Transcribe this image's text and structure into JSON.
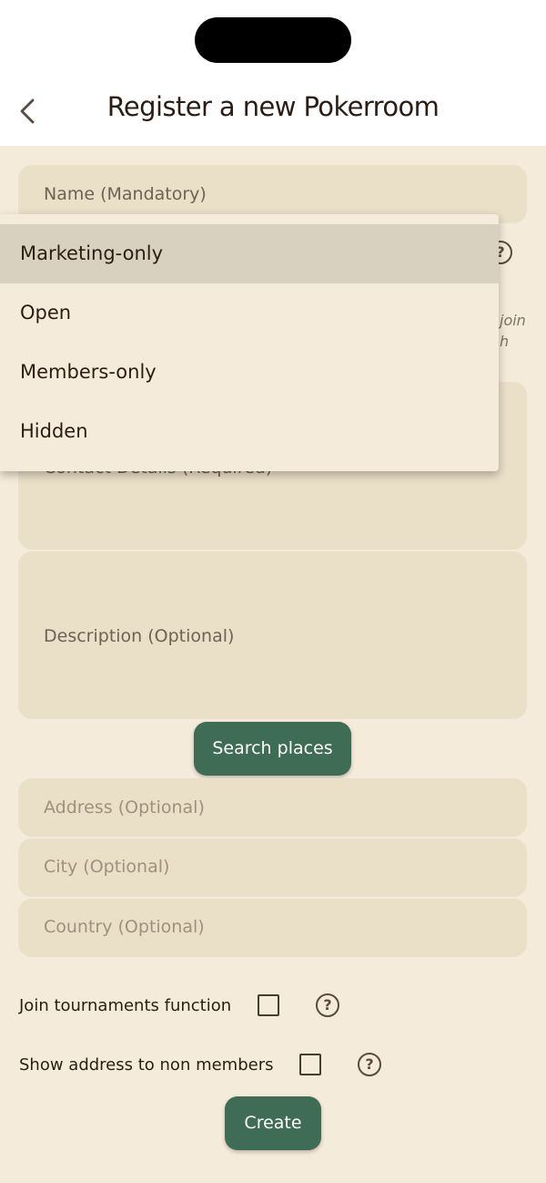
{
  "header": {
    "title": "Register a new Pokerroom"
  },
  "form": {
    "name_placeholder": "Name (Mandatory)",
    "hint_line1": "join",
    "hint_line2": "h",
    "contact_placeholder": "Contact Details (Required)",
    "description_placeholder": "Description (Optional)",
    "search_places_label": "Search places",
    "address_placeholder": "Address (Optional)",
    "city_placeholder": "City (Optional)",
    "country_placeholder": "Country (Optional)",
    "join_tournaments_label": "Join tournaments function",
    "show_address_label": "Show address to non members",
    "help_glyph": "?",
    "create_label": "Create"
  },
  "dropdown": {
    "options": [
      "Marketing-only",
      "Open",
      "Members-only",
      "Hidden"
    ],
    "selected": "Marketing-only"
  },
  "colors": {
    "background": "#f5ebda",
    "field": "#eadfc7",
    "accent": "#3e6c55",
    "selected_option": "#d9d1c0",
    "text": "#2b1d14"
  },
  "icons": {
    "back": "chevron-left-icon",
    "help": "question-circle-icon",
    "checkbox": "checkbox-unchecked-icon"
  }
}
